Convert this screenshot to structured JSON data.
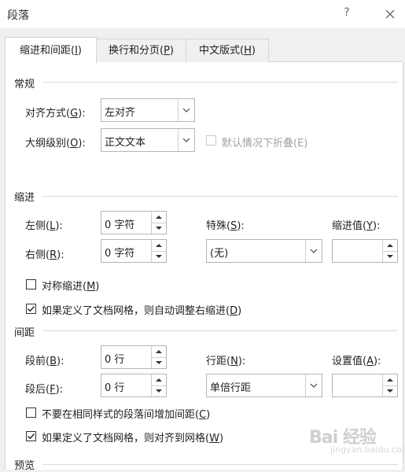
{
  "dialog": {
    "title": "段落",
    "help": "?"
  },
  "tabs": [
    {
      "label": "缩进和间距(",
      "key": "I",
      "end": ")",
      "active": true
    },
    {
      "label": "换行和分页(",
      "key": "P",
      "end": ")",
      "active": false
    },
    {
      "label": "中文版式(",
      "key": "H",
      "end": ")",
      "active": false
    }
  ],
  "general": {
    "heading": "常规",
    "alignment_label": "对齐方式(",
    "alignment_key": "G",
    "alignment_end": "):",
    "alignment_value": "左对齐",
    "outline_label": "大纲级别(",
    "outline_key": "O",
    "outline_end": "):",
    "outline_value": "正文文本",
    "collapse_label": "默认情况下折叠(E)"
  },
  "indent": {
    "heading": "缩进",
    "left_label": "左侧(",
    "left_key": "L",
    "left_end": "):",
    "left_value": "0 字符",
    "right_label": "右侧(",
    "right_key": "R",
    "right_end": "):",
    "right_value": "0 字符",
    "special_label": "特殊(",
    "special_key": "S",
    "special_end": "):",
    "special_value": "(无)",
    "by_label": "缩进值(",
    "by_key": "Y",
    "by_end": "):",
    "by_value": "",
    "mirror_label": "对称缩进(",
    "mirror_key": "M",
    "mirror_end": ")",
    "mirror_checked": false,
    "auto_adjust_label": "如果定义了文档网格，则自动调整右缩进(",
    "auto_adjust_key": "D",
    "auto_adjust_end": ")",
    "auto_adjust_checked": true
  },
  "spacing": {
    "heading": "间距",
    "before_label": "段前(",
    "before_key": "B",
    "before_end": "):",
    "before_value": "0 行",
    "after_label": "段后(",
    "after_key": "F",
    "after_end": "):",
    "after_value": "0 行",
    "line_label": "行距(",
    "line_key": "N",
    "line_end": "):",
    "line_value": "单倍行距",
    "at_label": "设置值(",
    "at_key": "A",
    "at_end": "):",
    "at_value": "",
    "no_space_label": "不要在相同样式的段落间增加间距(",
    "no_space_key": "C",
    "no_space_end": ")",
    "no_space_checked": false,
    "snap_grid_label": "如果定义了文档网格，则对齐到网格(",
    "snap_grid_key": "W",
    "snap_grid_end": ")",
    "snap_grid_checked": true
  },
  "preview": {
    "heading": "预览"
  },
  "watermark": {
    "text": "Bai 经验",
    "sub": "jingyan.baidu.com"
  }
}
